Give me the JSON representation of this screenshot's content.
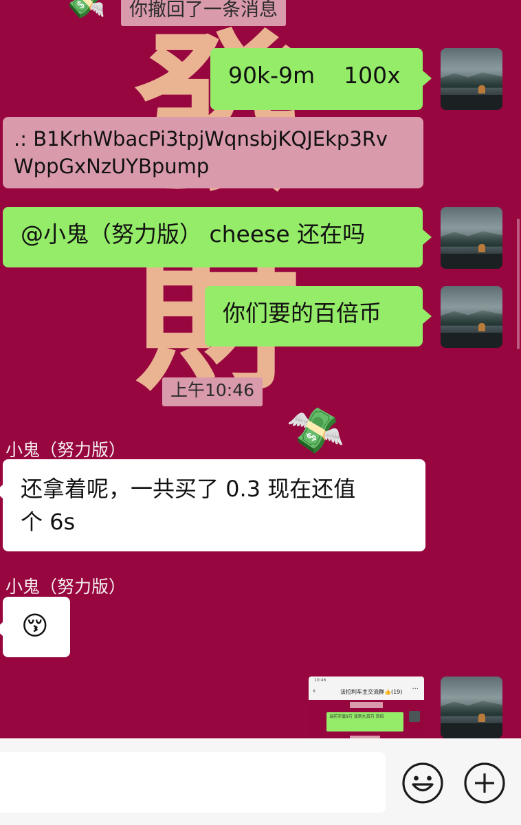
{
  "background": {
    "char_top": "發",
    "char_bottom": "財",
    "color": "#98063f"
  },
  "chat": {
    "recall_notice": "你撤回了一条消息",
    "messages": [
      {
        "direction": "out",
        "text": "90k-9m    100x"
      },
      {
        "direction": "in",
        "line1": ".: B1KrhWbacPi3tpjWqnsbjKQJEkp3Rv",
        "line2": "WppGxNzUYBpump"
      },
      {
        "direction": "out",
        "text": "@小鬼（努力版） cheese 还在吗"
      },
      {
        "direction": "out",
        "text": "你们要的百倍币"
      },
      {
        "direction": "in",
        "sender": "小鬼（努力版）",
        "line1": "还拿着呢，一共买了 0.3 现在还值",
        "line2": "个 6s"
      },
      {
        "direction": "in",
        "sender": "小鬼（努力版）",
        "text": "😚"
      }
    ],
    "timestamp": "上午10:46"
  },
  "screenshot_preview": {
    "status_time": "10:46",
    "title": "法拉利车主交流群👍(19)",
    "back_glyph": "‹",
    "more_glyph": "···",
    "bubble_text": "当前市值9万 涨到九百万 百倍"
  },
  "input_bar": {
    "placeholder": "",
    "value": ""
  },
  "icons": {
    "money": "💸",
    "emoji_button": "smiley-face-icon",
    "plus_button": "plus-circle-icon"
  },
  "colors": {
    "outgoing_bubble": "#95ec69",
    "incoming_bubble": "#ffffff",
    "tag": "#d99aac"
  }
}
